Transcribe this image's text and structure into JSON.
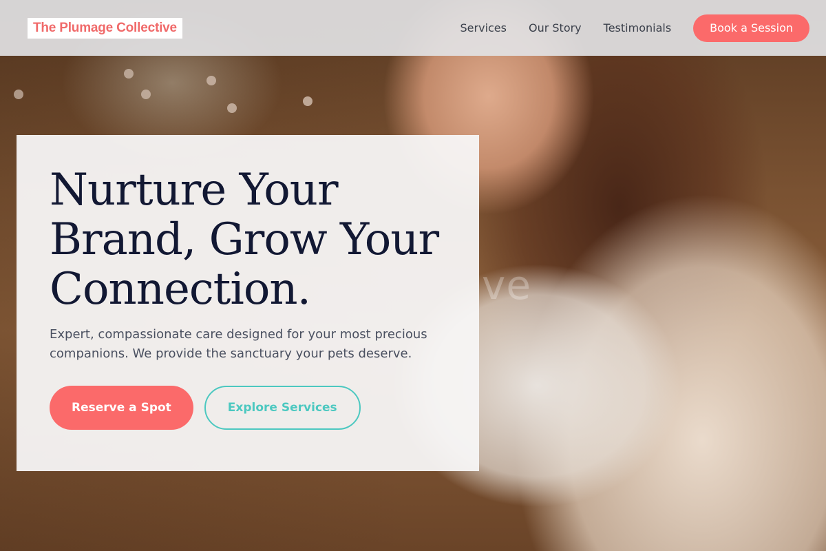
{
  "brand": {
    "name": "The Plumage Collective"
  },
  "nav": {
    "links": [
      "Services",
      "Our Story",
      "Testimonials"
    ],
    "cta_label": "Book a Session"
  },
  "hero": {
    "title": "Nurture Your Brand, Grow Your Connection.",
    "subtitle": "Expert, compassionate care designed for your most precious companions. We provide the sanctuary your pets deserve.",
    "primary_cta": "Reserve a Spot",
    "secondary_cta": "Explore Services",
    "background_text": "ve"
  },
  "colors": {
    "accent": "#fb6a6a",
    "secondary": "#4cc8c0",
    "heading": "#121833",
    "body_text": "#4a5060"
  }
}
